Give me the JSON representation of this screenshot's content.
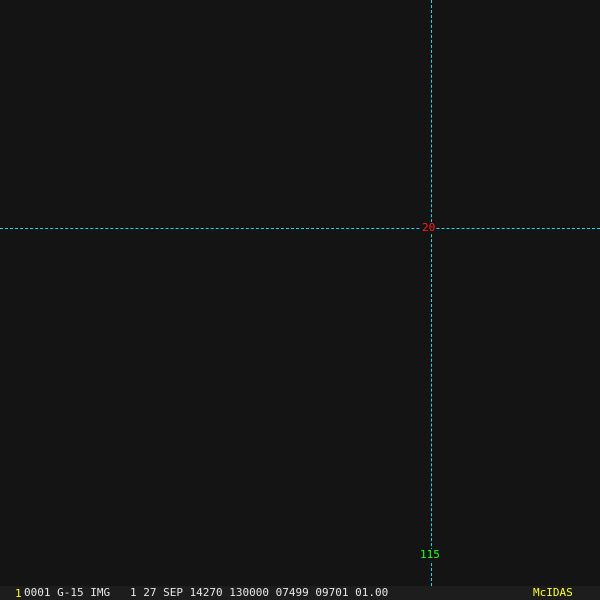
{
  "overlay": {
    "latitude_label": "20",
    "longitude_label": "115",
    "grid_color": "#22d8e8",
    "latitude_label_color": "#ff2020",
    "longitude_label_color": "#20ff20"
  },
  "status_bar": {
    "frame_number": "1",
    "info": "0001 G-15 IMG   1 27 SEP 14270 130000 07499 09701 01.00",
    "brand": "McIDAS"
  }
}
